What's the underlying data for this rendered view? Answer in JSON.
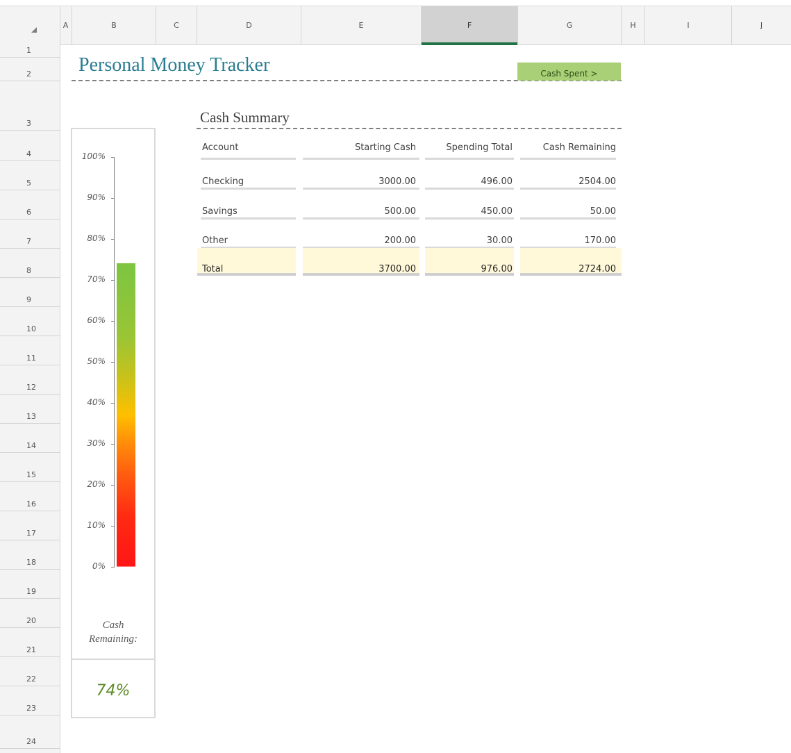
{
  "columns": [
    "A",
    "B",
    "C",
    "D",
    "E",
    "F",
    "G",
    "H",
    "I",
    "J"
  ],
  "selected_column": "F",
  "rows": [
    "1",
    "2",
    "3",
    "4",
    "5",
    "6",
    "7",
    "8",
    "9",
    "10",
    "11",
    "12",
    "13",
    "14",
    "15",
    "16",
    "17",
    "18",
    "19",
    "20",
    "21",
    "22",
    "23",
    "24"
  ],
  "sheet": {
    "title": "Personal Money Tracker",
    "cash_spent_button": "Cash Spent >"
  },
  "summary": {
    "title": "Cash Summary",
    "headers": [
      "Account",
      "Starting Cash",
      "Spending Total",
      "Cash Remaining"
    ],
    "rows": [
      {
        "account": "Checking",
        "starting": "3000.00",
        "spending": "496.00",
        "remaining": "2504.00"
      },
      {
        "account": "Savings",
        "starting": "500.00",
        "spending": "450.00",
        "remaining": "50.00"
      },
      {
        "account": "Other",
        "starting": "200.00",
        "spending": "30.00",
        "remaining": "170.00"
      }
    ],
    "total": {
      "account": "Total",
      "starting": "3700.00",
      "spending": "976.00",
      "remaining": "2724.00"
    }
  },
  "gauge": {
    "ticks": [
      "100%",
      "90%",
      "80%",
      "70%",
      "60%",
      "50%",
      "40%",
      "30%",
      "20%",
      "10%",
      "0%"
    ],
    "level": 0.74,
    "label_line1": "Cash",
    "label_line2": "Remaining:",
    "percent_text": "74%"
  },
  "colors": {
    "title": "#2a7d91",
    "button": "#a9cf77",
    "total_fill": "#fff9d9",
    "percent": "#5e8a28"
  }
}
